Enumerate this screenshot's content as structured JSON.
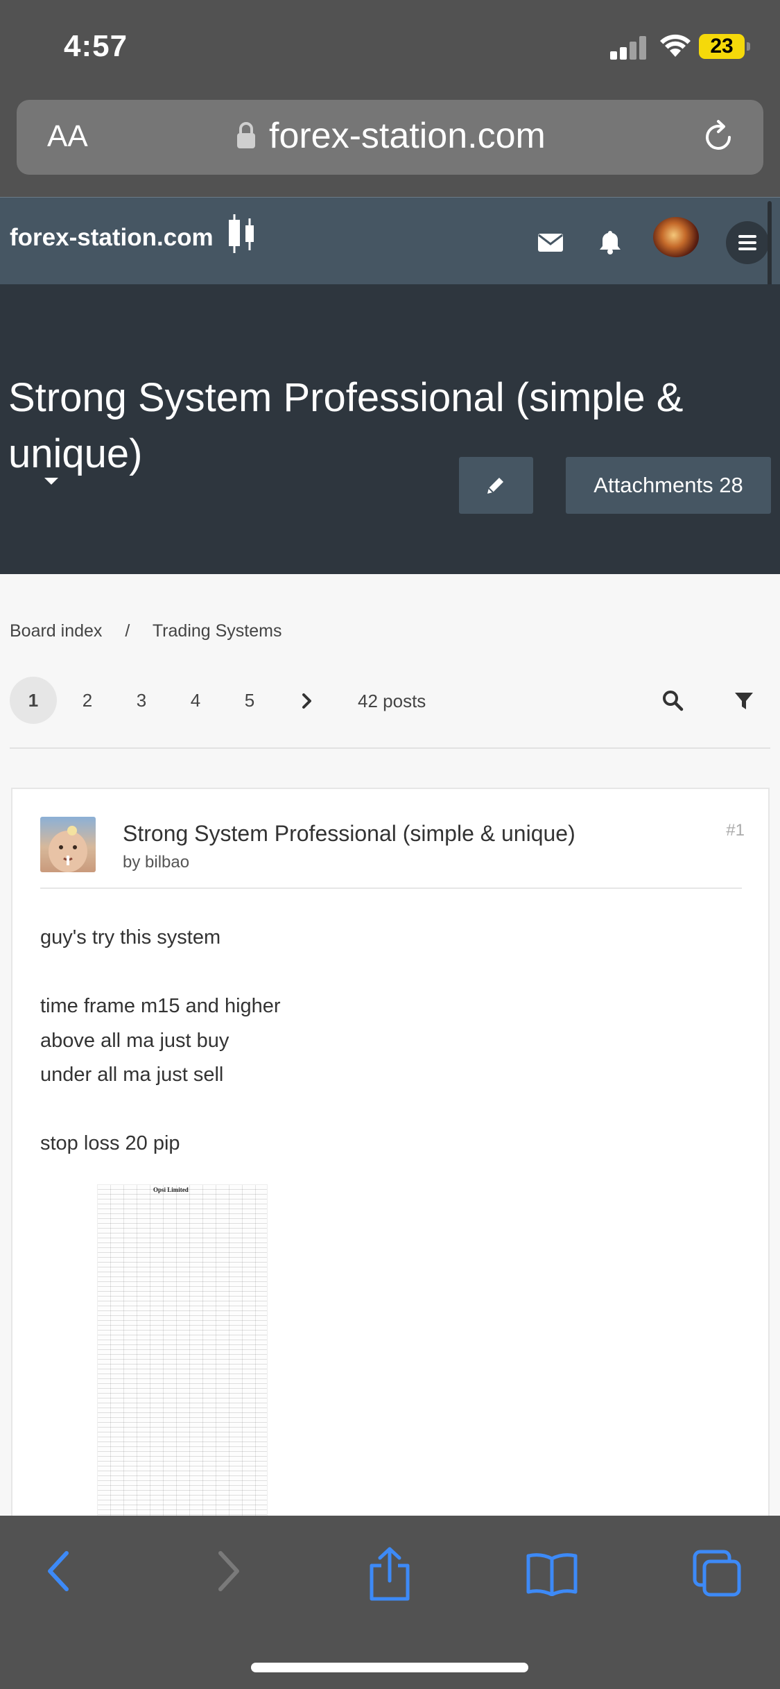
{
  "status": {
    "time": "4:57",
    "battery": "23"
  },
  "browser": {
    "text_size_label": "AA",
    "url": "forex-station.com"
  },
  "site": {
    "logo_text": "forex-station.com"
  },
  "topic": {
    "title": "Strong System Professional (simple & unique)",
    "attachments_label": "Attachments 28"
  },
  "breadcrumb": {
    "items": [
      "Board index",
      "/",
      "Trading Systems"
    ]
  },
  "pagination": {
    "pages": [
      "1",
      "2",
      "3",
      "4",
      "5"
    ],
    "current": "1",
    "posts_count": "42 posts"
  },
  "post": {
    "title": "Strong System Professional (simple & unique)",
    "author": "by bilbao",
    "number": "#1",
    "lines": [
      "guy's try this system",
      "",
      "time frame m15 and higher",
      "above all ma just buy",
      "under all ma just sell",
      "",
      "stop loss 20 pip"
    ],
    "attachment_title": "Opsi Limited"
  },
  "colors": {
    "safari_chrome": "#525252",
    "site_header": "#465663",
    "title_band": "#2e363e",
    "accent_blue": "#3d8af7"
  }
}
